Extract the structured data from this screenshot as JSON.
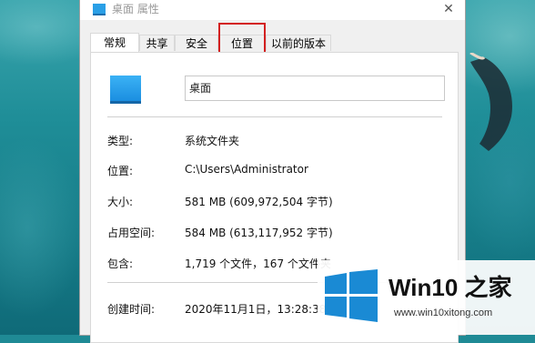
{
  "window": {
    "title": "桌面 属性",
    "close_glyph": "✕"
  },
  "tabs": [
    {
      "label": "常规",
      "active": true
    },
    {
      "label": "共享",
      "active": false
    },
    {
      "label": "安全",
      "active": false
    },
    {
      "label": "位置",
      "active": false,
      "highlighted": true
    },
    {
      "label": "以前的版本",
      "active": false
    }
  ],
  "general": {
    "folder_name": "桌面",
    "props": [
      {
        "label": "类型:",
        "value": "系统文件夹"
      },
      {
        "label": "位置:",
        "value": "C:\\Users\\Administrator"
      },
      {
        "label": "大小:",
        "value": "581 MB (609,972,504 字节)"
      },
      {
        "label": "占用空间:",
        "value": "584 MB (613,117,952 字节)"
      },
      {
        "label": "包含:",
        "value": "1,719 个文件，167 个文件夹"
      },
      {
        "label": "创建时间:",
        "value": "2020年11月1日，13:28:38"
      }
    ]
  },
  "watermark": {
    "title": "Win10 之家",
    "url": "www.win10xitong.com"
  },
  "colors": {
    "highlight": "#d32121",
    "folder_icon": "#2a9fe6",
    "windows_logo": "#1a8ad4"
  }
}
